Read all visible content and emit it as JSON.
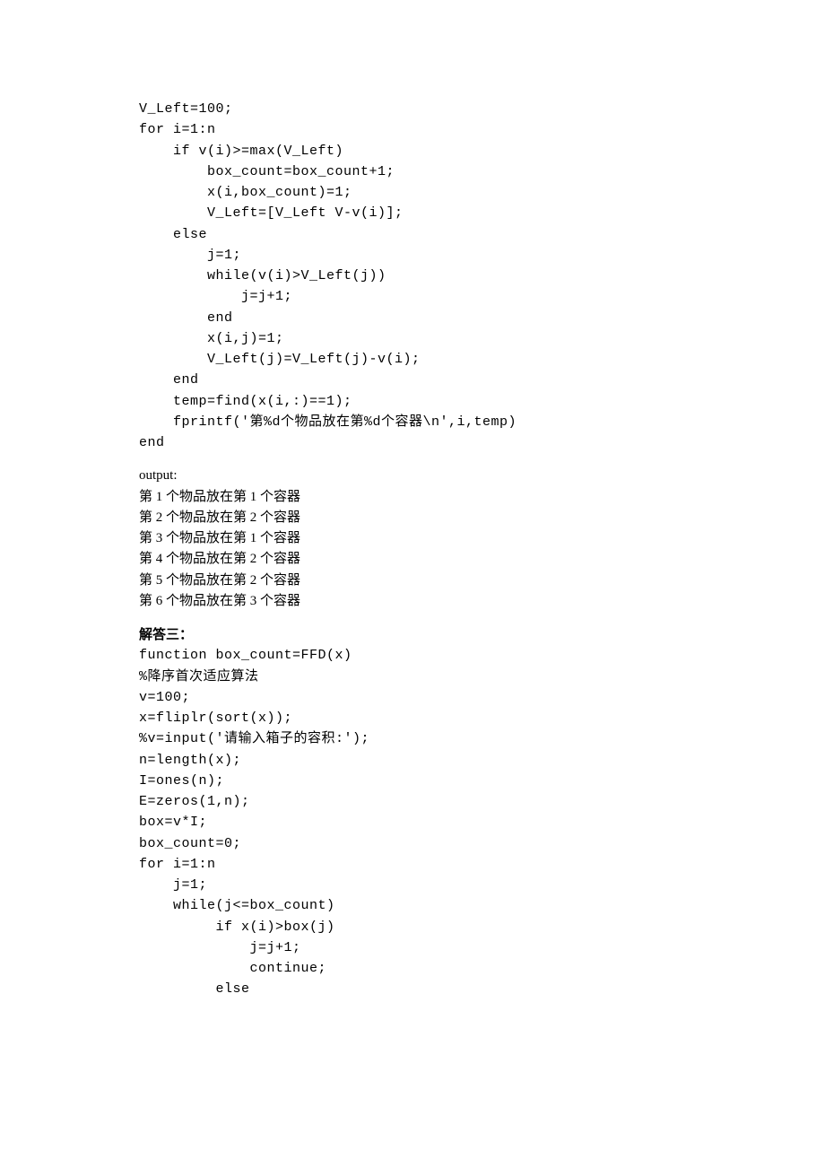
{
  "code_block_1": "V_Left=100;\nfor i=1:n\n    if v(i)>=max(V_Left)\n        box_count=box_count+1;\n        x(i,box_count)=1;\n        V_Left=[V_Left V-v(i)];\n    else\n        j=1;\n        while(v(i)>V_Left(j))\n            j=j+1;\n        end\n        x(i,j)=1;\n        V_Left(j)=V_Left(j)-v(i);\n    end\n    temp=find(x(i,:)==1);\n    fprintf('第%d个物品放在第%d个容器\\n',i,temp)\nend",
  "output_label": "output:",
  "output_lines": "第 1 个物品放在第 1 个容器\n第 2 个物品放在第 2 个容器\n第 3 个物品放在第 1 个容器\n第 4 个物品放在第 2 个容器\n第 5 个物品放在第 2 个容器\n第 6 个物品放在第 3 个容器",
  "section_heading": "解答三：",
  "code_block_2": "function box_count=FFD(x)\n%降序首次适应算法\nv=100;\nx=fliplr(sort(x));\n%v=input('请输入箱子的容积:');\nn=length(x);\nI=ones(n);\nE=zeros(1,n);\nbox=v*I;\nbox_count=0;\nfor i=1:n\n    j=1;\n    while(j<=box_count)\n         if x(i)>box(j)\n             j=j+1;\n             continue;\n         else"
}
